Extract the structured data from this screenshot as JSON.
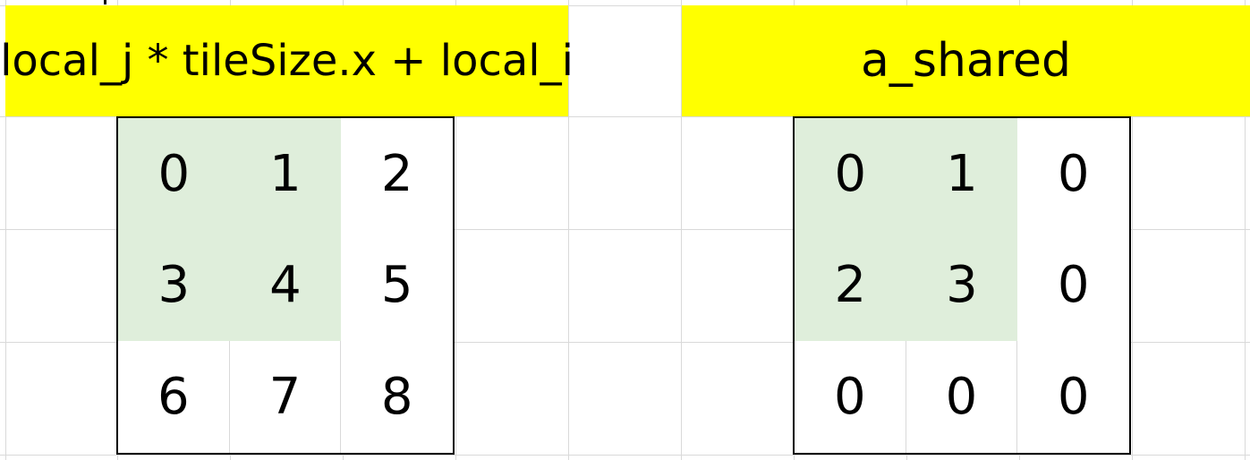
{
  "headers": {
    "left": "local_j * tileSize.x + local_i",
    "right": "a_shared"
  },
  "colors": {
    "header_bg": "#ffff00",
    "highlight_bg": "#dfeedb",
    "grid_line": "#d9d9d9"
  },
  "matrices": {
    "left": {
      "cells": [
        "0",
        "1",
        "2",
        "3",
        "4",
        "5",
        "6",
        "7",
        "8"
      ],
      "highlighted": [
        true,
        true,
        false,
        true,
        true,
        false,
        false,
        false,
        false
      ]
    },
    "right": {
      "cells": [
        "0",
        "1",
        "0",
        "2",
        "3",
        "0",
        "0",
        "0",
        "0"
      ],
      "highlighted": [
        true,
        true,
        false,
        true,
        true,
        false,
        false,
        false,
        false
      ]
    }
  }
}
